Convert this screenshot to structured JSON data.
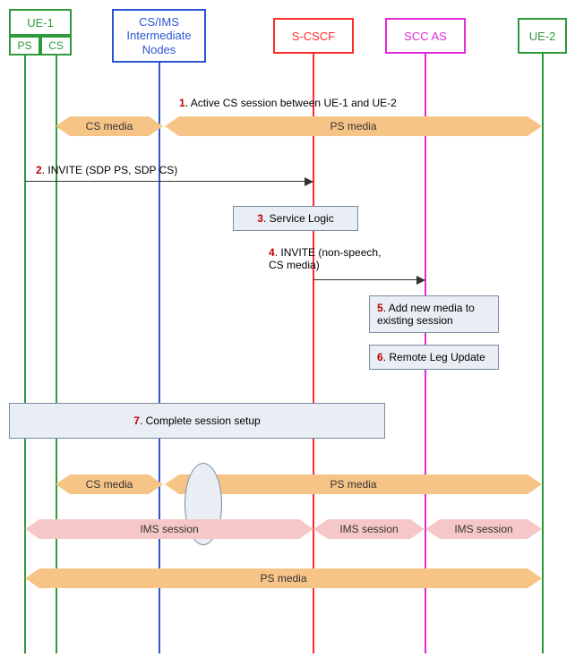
{
  "chart_data": {
    "type": "sequence-diagram",
    "actors": [
      {
        "id": "ue1",
        "label": "UE-1",
        "subs": [
          "PS",
          "CS"
        ],
        "color": "#2e9a3a"
      },
      {
        "id": "intermediate",
        "label": "CS/IMS Intermediate Nodes",
        "color": "#2b55d4"
      },
      {
        "id": "scscf",
        "label": "S-CSCF",
        "color": "#ff2a2a"
      },
      {
        "id": "sccas",
        "label": "SCC AS",
        "color": "#e428d6"
      },
      {
        "id": "ue2",
        "label": "UE-2",
        "color": "#2e9a3a"
      }
    ],
    "steps": [
      {
        "n": "1",
        "text": "Active CS session between UE-1 and UE-2"
      },
      {
        "n": "2",
        "text": "INVITE (SDP PS, SDP CS)"
      },
      {
        "n": "3",
        "text": "Service Logic"
      },
      {
        "n": "4",
        "text": "INVITE (non-speech, CS media)"
      },
      {
        "n": "5",
        "text": "Add new media to existing session"
      },
      {
        "n": "6",
        "text": "Remote Leg Update"
      },
      {
        "n": "7",
        "text": "Complete session setup"
      }
    ],
    "media_labels": {
      "cs": "CS media",
      "ps": "PS media",
      "ims": "IMS session"
    }
  }
}
